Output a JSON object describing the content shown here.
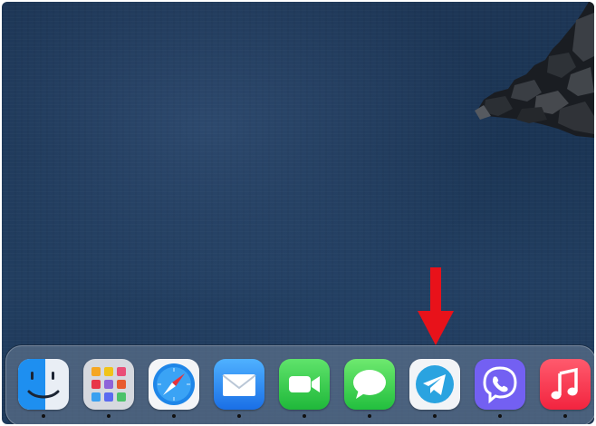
{
  "desktop": {
    "wallpaper": "ocean-with-rocky-coast"
  },
  "annotation": {
    "type": "arrow",
    "color": "#e8121a",
    "points_to": "Telegram"
  },
  "dock": {
    "apps": [
      {
        "name": "Finder",
        "icon": "finder-icon",
        "running": true
      },
      {
        "name": "Launchpad",
        "icon": "launchpad-icon",
        "running": true
      },
      {
        "name": "Safari",
        "icon": "safari-icon",
        "running": true
      },
      {
        "name": "Mail",
        "icon": "mail-icon",
        "running": true
      },
      {
        "name": "FaceTime",
        "icon": "facetime-icon",
        "running": true
      },
      {
        "name": "Messages",
        "icon": "messages-icon",
        "running": true
      },
      {
        "name": "Telegram",
        "icon": "telegram-icon",
        "running": true
      },
      {
        "name": "Viber",
        "icon": "viber-icon",
        "running": true
      },
      {
        "name": "Music",
        "icon": "music-icon",
        "running": true
      }
    ]
  }
}
